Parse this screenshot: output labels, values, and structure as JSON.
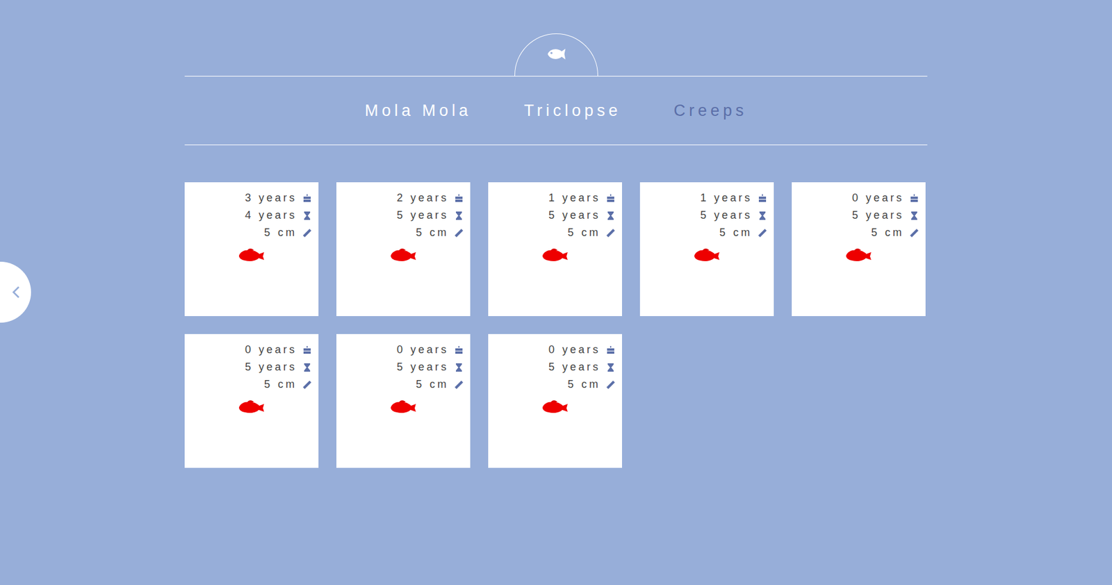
{
  "tabs": [
    {
      "label": "Mola Mola",
      "selected": false
    },
    {
      "label": "Triclopse",
      "selected": false
    },
    {
      "label": "Creeps",
      "selected": true
    }
  ],
  "fish": [
    {
      "age": "3 years",
      "lifespan": "4 years",
      "size": "5 cm"
    },
    {
      "age": "2 years",
      "lifespan": "5 years",
      "size": "5 cm"
    },
    {
      "age": "1 years",
      "lifespan": "5 years",
      "size": "5 cm"
    },
    {
      "age": "1 years",
      "lifespan": "5 years",
      "size": "5 cm"
    },
    {
      "age": "0 years",
      "lifespan": "5 years",
      "size": "5 cm"
    },
    {
      "age": "0 years",
      "lifespan": "5 years",
      "size": "5 cm"
    },
    {
      "age": "0 years",
      "lifespan": "5 years",
      "size": "5 cm"
    },
    {
      "age": "0 years",
      "lifespan": "5 years",
      "size": "5 cm"
    }
  ]
}
